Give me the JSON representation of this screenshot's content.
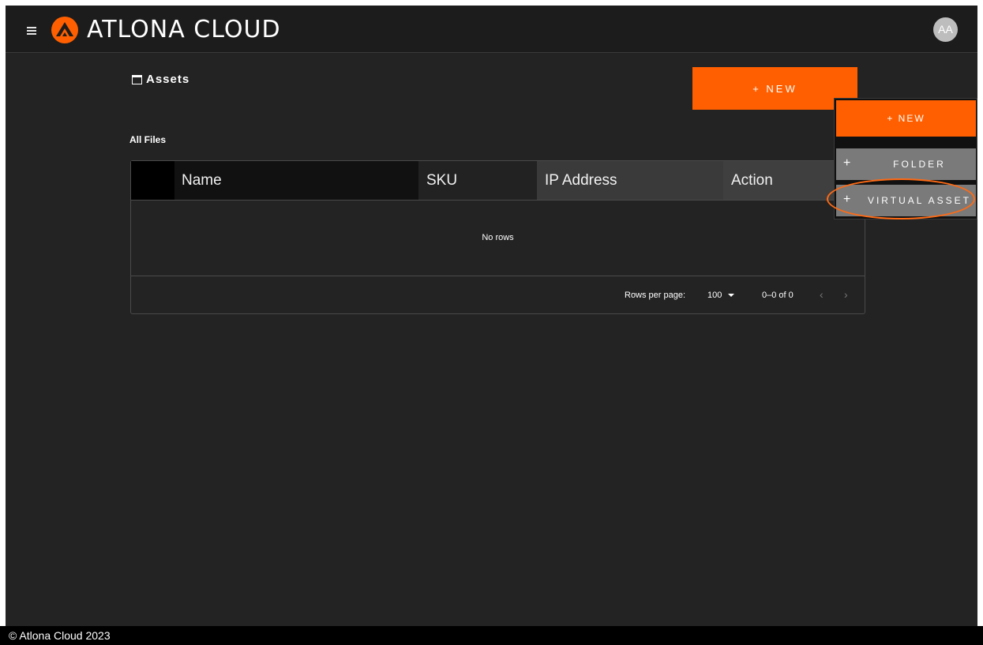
{
  "header": {
    "brand": "ATLONA CLOUD",
    "avatar_initials": "AA",
    "accent_color": "#ff5f00",
    "menu_icon": "hamburger-icon",
    "logo_icon": "atlona-logo-icon"
  },
  "page": {
    "title": "Assets",
    "title_icon": "folder-icon",
    "new_button": "+ NEW",
    "section_label": "All Files"
  },
  "table": {
    "columns": [
      "Name",
      "SKU",
      "IP Address",
      "Action"
    ],
    "empty_text": "No rows",
    "rows_per_page_label": "Rows per page:",
    "rows_per_page_value": "100",
    "range_text": "0–0 of 0",
    "prev_icon": "chevron-left-icon",
    "next_icon": "chevron-right-icon"
  },
  "new_menu": {
    "header": "+ NEW",
    "items": [
      {
        "icon": "+",
        "label": "FOLDER"
      },
      {
        "icon": "+",
        "label": "VIRTUAL ASSET"
      }
    ]
  },
  "footer": {
    "copyright": "© Atlona Cloud 2023"
  }
}
